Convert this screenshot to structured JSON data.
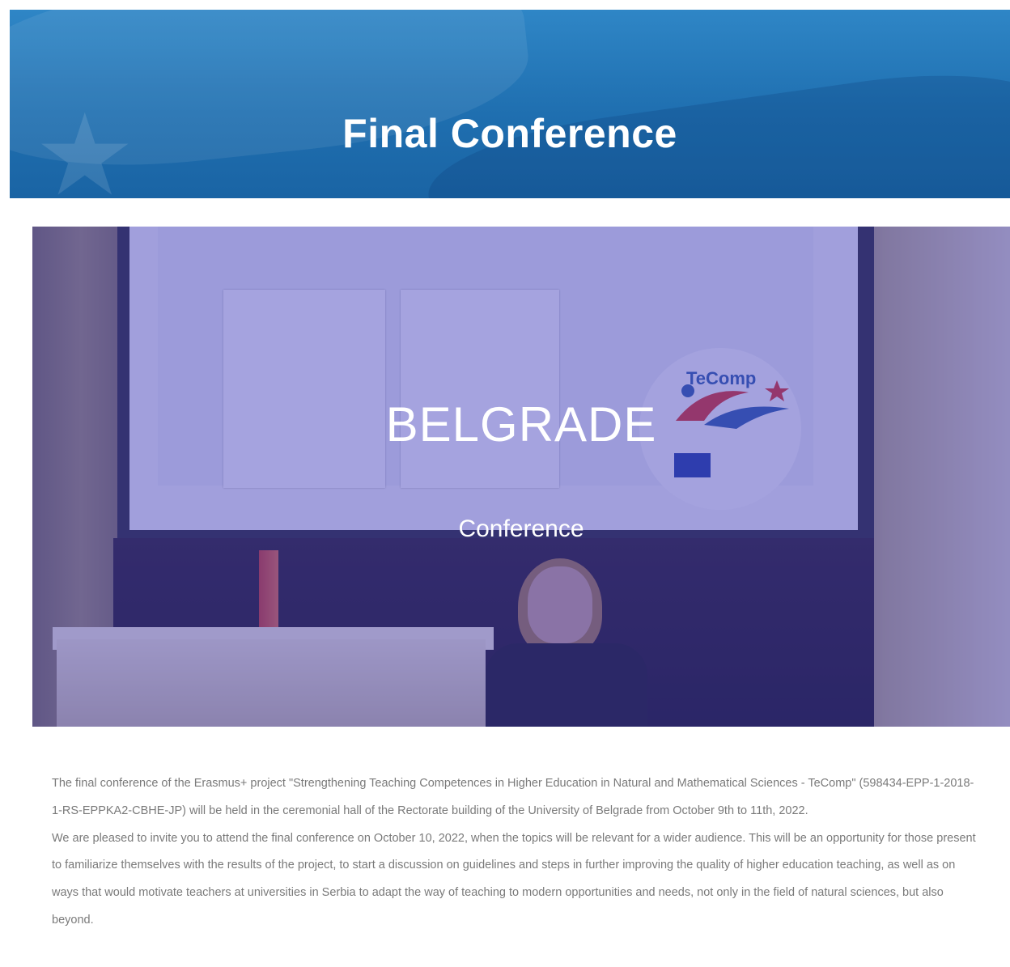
{
  "banner": {
    "title": "Final Conference"
  },
  "hero": {
    "title": "BELGRADE",
    "subtitle": "Conference",
    "overlay_color": "#403cbe",
    "screen_logo_text": "TeComp"
  },
  "article": {
    "paragraph1": "The final conference of the Erasmus+ project \"Strengthening Teaching Competences in Higher Education in Natural and Mathematical Sciences - TeComp\" (598434-EPP-1-2018-1-RS-EPPKA2-CBHE-JP) will be held in the ceremonial hall of the Rectorate building of the University of Belgrade from October 9th to 11th, 2022.",
    "paragraph2": "We are pleased to invite you to attend the final conference on October 10, 2022, when the topics will be relevant for a wider audience. This will be an opportunity for those present to familiarize themselves with the results of the project, to start a discussion on guidelines and steps in further improving the quality of higher education teaching, as well as on ways that would motivate teachers at universities in Serbia to adapt the way of teaching to modern opportunities and needs, not only in the field of natural sciences, but also beyond."
  },
  "colors": {
    "banner": "#1f6fb0",
    "body_text": "#7a7a7a"
  }
}
